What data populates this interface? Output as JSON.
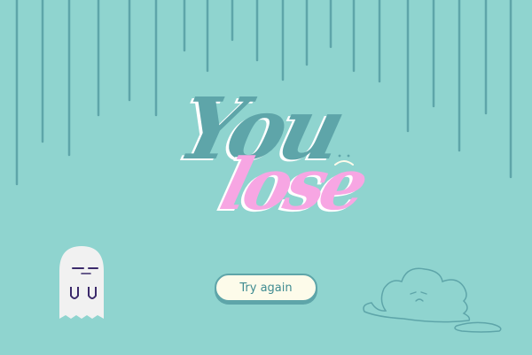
{
  "screen": {
    "title_line1": "You",
    "title_line2": "lose",
    "retry_button_label": "Try again"
  },
  "colors": {
    "background": "#8fd4cf",
    "rain": "#5ea5a9",
    "title_you": "#5ea5a9",
    "title_lose": "#f7a6e3",
    "button_fill": "#fdfbea",
    "button_text": "#3f8b91",
    "ghost_body": "#f1f1f1",
    "ghost_face": "#3b2a6b"
  },
  "icons": {
    "sad_face": "sad-face-icon",
    "ghost": "ghost-character",
    "cloud": "melting-cloud"
  }
}
